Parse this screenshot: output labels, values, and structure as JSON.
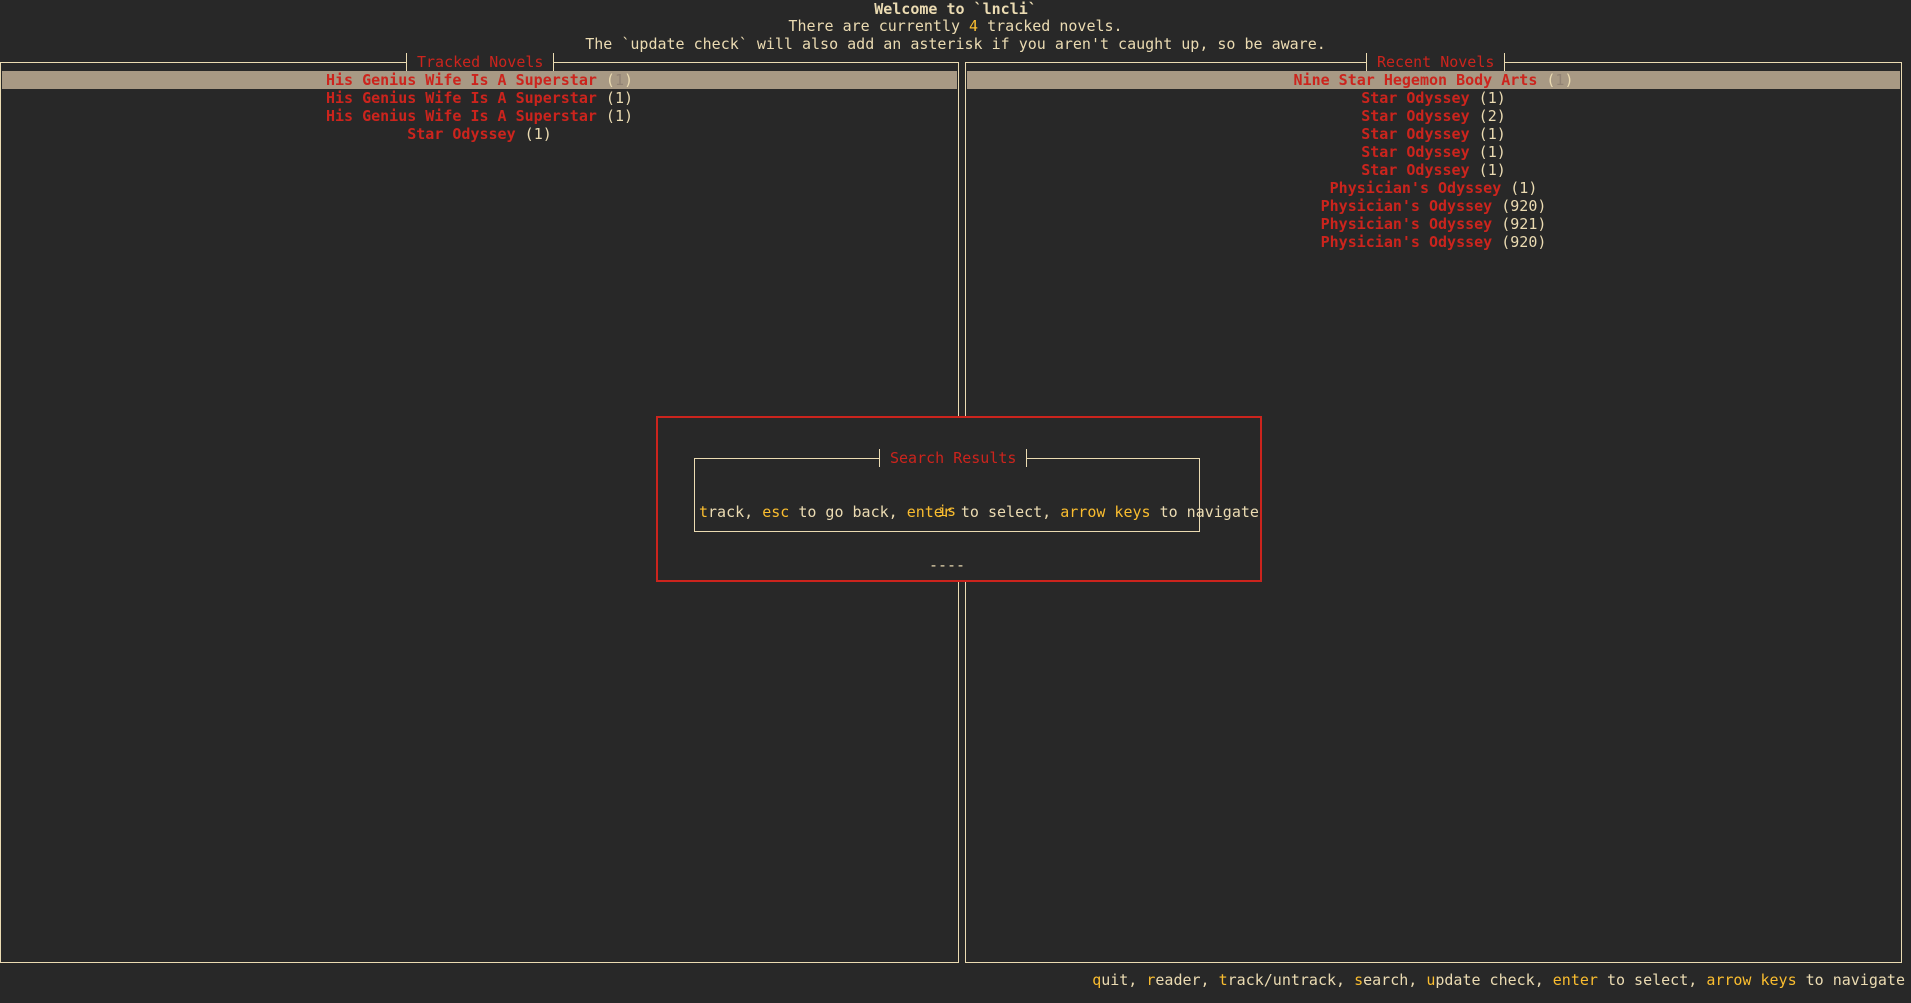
{
  "header": {
    "welcome": "Welcome to `lncli`",
    "count_prefix": "There are currently ",
    "count": "4",
    "count_suffix": " tracked novels.",
    "notice": "The `update check` will also add an asterisk if you aren't caught up, so be aware."
  },
  "tracked": {
    "title": "Tracked Novels",
    "items": [
      {
        "title": "His Genius Wife Is A Superstar",
        "count": "1"
      },
      {
        "title": "His Genius Wife Is A Superstar",
        "count": "1"
      },
      {
        "title": "His Genius Wife Is A Superstar",
        "count": "1"
      },
      {
        "title": "Star Odyssey",
        "count": "1"
      }
    ]
  },
  "recent": {
    "title": "Recent Novels",
    "items": [
      {
        "title": "Nine Star Hegemon Body Arts",
        "count": "1"
      },
      {
        "title": "Star Odyssey",
        "count": "1"
      },
      {
        "title": "Star Odyssey",
        "count": "2"
      },
      {
        "title": "Star Odyssey",
        "count": "1"
      },
      {
        "title": "Star Odyssey",
        "count": "1"
      },
      {
        "title": "Star Odyssey",
        "count": "1"
      },
      {
        "title": "Physician's Odyssey",
        "count": "1"
      },
      {
        "title": "Physician's Odyssey",
        "count": "920"
      },
      {
        "title": "Physician's Odyssey",
        "count": "921"
      },
      {
        "title": "Physician's Odyssey",
        "count": "920"
      }
    ]
  },
  "search": {
    "title": "Search Results",
    "query": "is",
    "separator": "----",
    "help": {
      "k1": "t",
      "t1": "rack, ",
      "k2": "esc",
      "t2": " to go back, ",
      "k3": "enter",
      "t3": " to select, ",
      "k4": "arrow keys",
      "t4": " to navigate"
    }
  },
  "footer": {
    "k1": "q",
    "t1": "uit, ",
    "k2": "r",
    "t2": "eader, ",
    "k3": "t",
    "t3": "rack/untrack, ",
    "k4": "s",
    "t4": "earch, ",
    "k5": "u",
    "t5": "pdate check, ",
    "k6": "enter",
    "t6": " to select, ",
    "k7": "arrow keys",
    "t7": " to navigate"
  },
  "colors": {
    "background": "#282828",
    "foreground": "#ebdbb2",
    "accent_red": "#cc241d",
    "key_yellow": "#fabd2f",
    "selection": "#a89984"
  }
}
